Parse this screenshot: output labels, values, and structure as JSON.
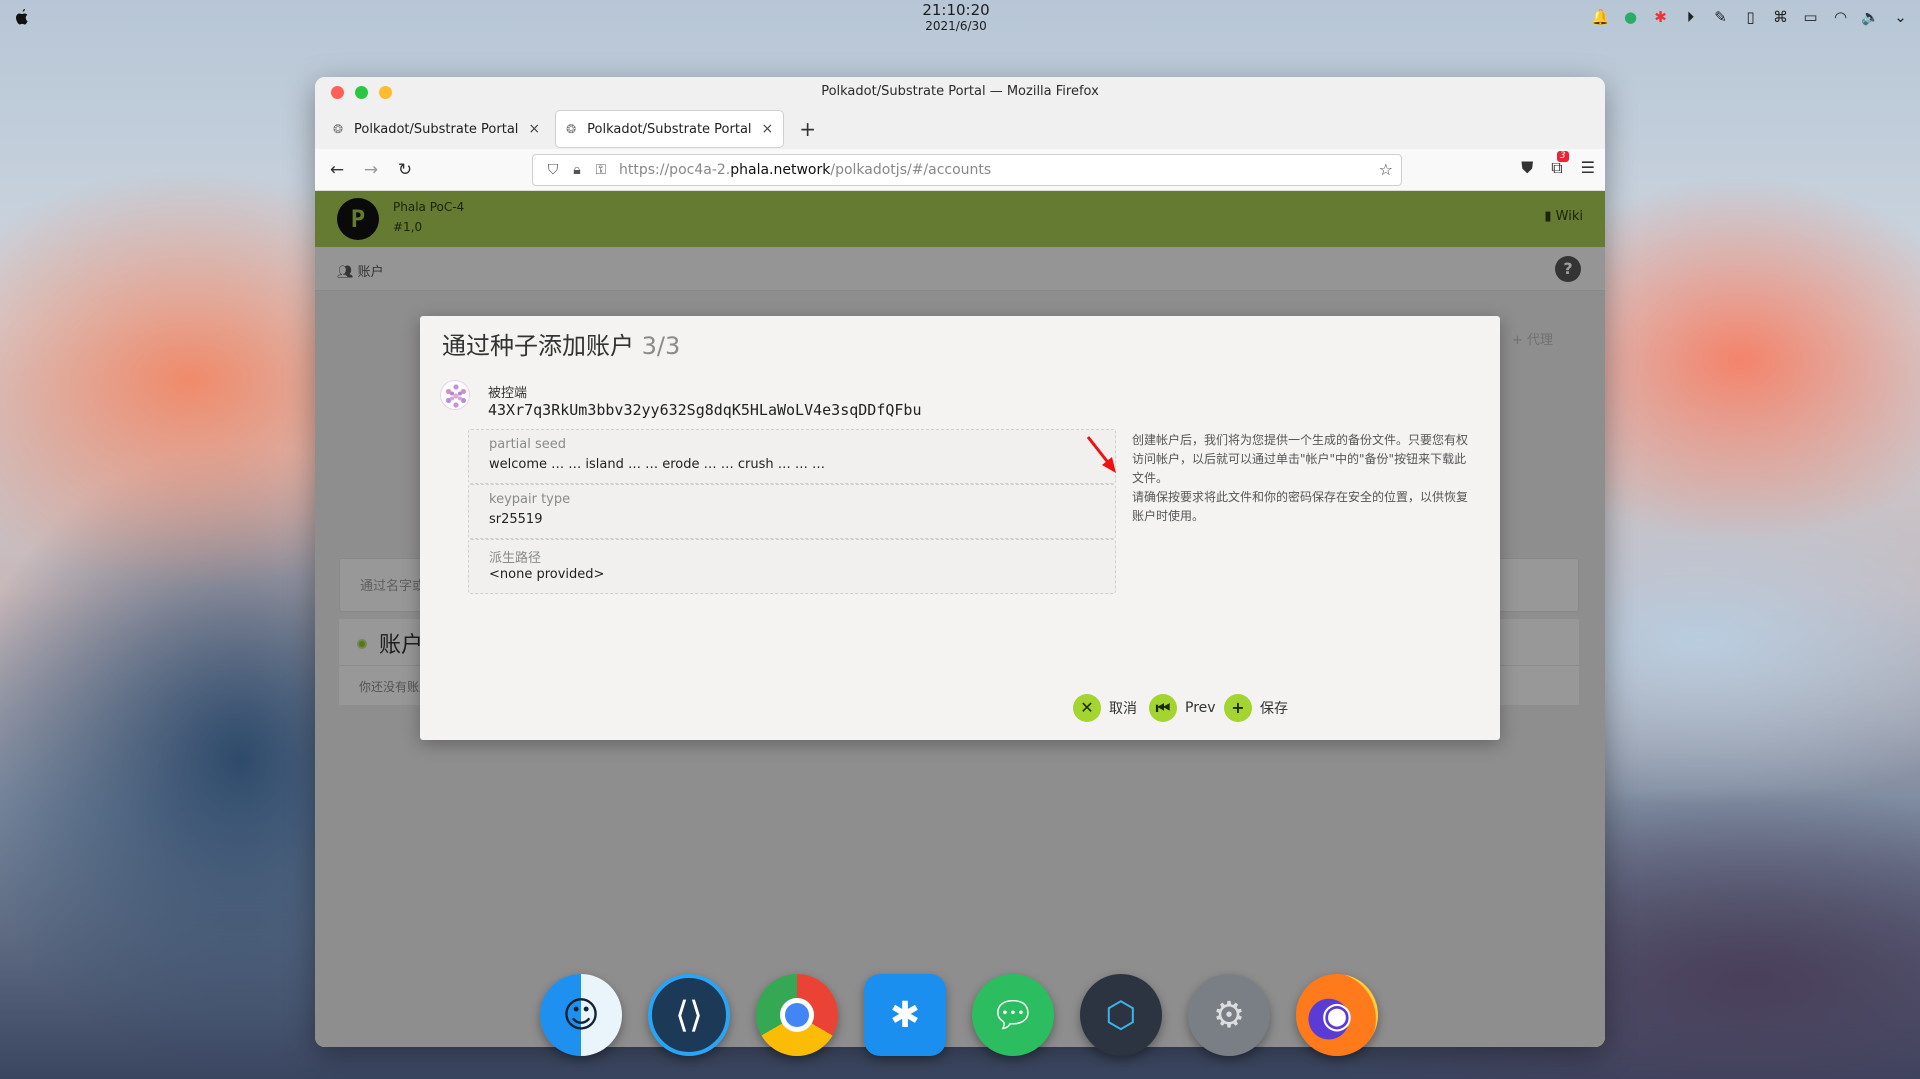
{
  "system": {
    "time": "21:10:20",
    "date": "2021/6/30"
  },
  "browser": {
    "window_title": "Polkadot/Substrate Portal — Mozilla Firefox",
    "tabs": [
      {
        "label": "Polkadot/Substrate Portal"
      },
      {
        "label": "Polkadot/Substrate Portal"
      }
    ],
    "url_prefix": "https://poc4a-2.",
    "url_host": "phala.network",
    "url_path": "/polkadotjs/#/accounts",
    "extension_badge": "3"
  },
  "app": {
    "chain_name": "Phala PoC-4",
    "block": "#1,0",
    "wiki_label": "Wiki",
    "nav_accounts": "账户",
    "proxy_label": "代理",
    "filter_placeholder": "通过名字或标签过滤",
    "accounts_title": "账户",
    "accounts_empty": "你还没有账户。很多功能对你隐藏了，赶紧添加一个账号试试。"
  },
  "modal": {
    "title": "通过种子添加账户",
    "step": "3/3",
    "account_label": "被控端",
    "address": "43Xr7q3RkUm3bbv32yy632Sg8dqK5HLaWoLV4e3sqDDfQFbu",
    "fields": [
      {
        "key": "partial seed",
        "value": "welcome … … island … … erode … … crush … … …"
      },
      {
        "key": "keypair type",
        "value": "sr25519"
      },
      {
        "key": "派生路径",
        "value": "<none provided>"
      }
    ],
    "help_1": "创建帐户后，我们将为您提供一个生成的备份文件。只要您有权访问帐户，以后就可以通过单击\"帐户\"中的\"备份\"按钮来下载此文件。",
    "help_2": "请确保按要求将此文件和你的密码保存在安全的位置，以供恢复账户时使用。",
    "cancel_label": "取消",
    "prev_label": "Prev",
    "save_label": "保存"
  },
  "colors": {
    "accent": "#a3c74f",
    "button": "#a3d42f"
  }
}
